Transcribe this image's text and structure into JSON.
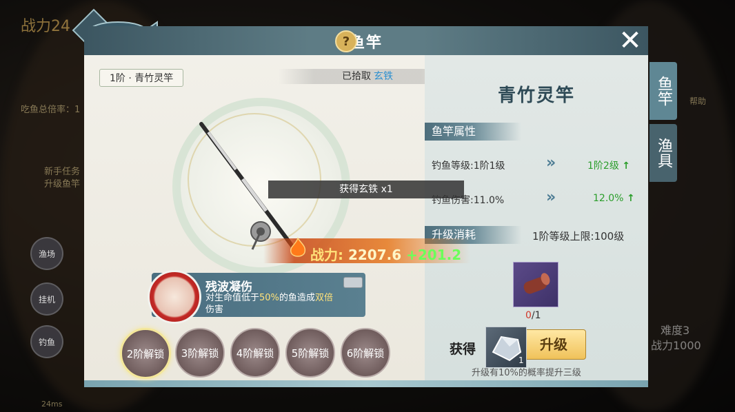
{
  "window": {
    "title": "鱼竿"
  },
  "background_hud": {
    "power_partial": "战力24",
    "stat_text": "吃鱼总倍率：1",
    "new_activity": "新手任务",
    "activity_sub": "升级鱼竿",
    "help_label": "帮助",
    "difficulty": "难度3",
    "difficulty_power": "战力1000",
    "ping": "24ms",
    "buttons": [
      "渔场",
      "挂机",
      "钓鱼"
    ]
  },
  "rod": {
    "stage_tag": "1阶 · 青竹灵竿",
    "picked_label": "已拾取",
    "picked_item": "玄铁",
    "toast": "获得玄铁 x1",
    "power_label": "战力:",
    "power_value": "2207.6",
    "power_delta": "+201.2"
  },
  "skill": {
    "name": "残波凝伤",
    "desc_prefix": "对生命值低于",
    "desc_pct": "50%",
    "desc_mid": "的鱼造成",
    "desc_highlight": "双倍",
    "desc_suffix": "伤害"
  },
  "unlocks": [
    "2阶解锁",
    "3阶解锁",
    "4阶解锁",
    "5阶解锁",
    "6阶解锁"
  ],
  "detail": {
    "rod_name": "青竹灵竿",
    "attr_header": "鱼竿属性",
    "attrs": [
      {
        "label": "钓鱼等级:1阶1级",
        "next": "1阶2级"
      },
      {
        "label": "钓鱼伤害:11.0%",
        "next": "12.0%"
      }
    ],
    "cost_header": "升级消耗",
    "level_limit": "1阶等级上限:100级",
    "material_have": "0",
    "material_need": "/1",
    "upgrade_label": "升级",
    "upgrade_note": "升级有10%的概率提升三级"
  },
  "side_tabs": [
    {
      "label": "鱼竿",
      "active": true
    },
    {
      "label": "渔具",
      "active": false
    }
  ],
  "obtain": {
    "label": "获得",
    "count": "1"
  },
  "colors": {
    "accent": "#4d6e7c",
    "green": "#2a9d2a",
    "highlight": "#ffe27a"
  }
}
